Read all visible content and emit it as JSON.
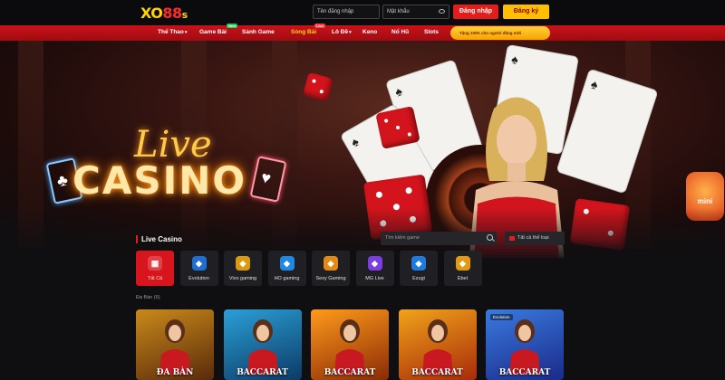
{
  "header": {
    "logo": {
      "main": "XO",
      "num": "88",
      "suffix": "s"
    },
    "username_placeholder": "Tên đăng nhập",
    "password_placeholder": "Mật khẩu",
    "login_label": "Đăng nhập",
    "register_label": "Đăng ký"
  },
  "nav": {
    "items": [
      {
        "label": "Thể Thao",
        "chevron": "▾"
      },
      {
        "label": "Game Bài",
        "badge": "New"
      },
      {
        "label": "Sảnh Game"
      },
      {
        "label": "Sòng Bài",
        "badge": "Live"
      },
      {
        "label": "Lô Đề",
        "chevron": "▾"
      },
      {
        "label": "Keno"
      },
      {
        "label": "Nổ Hũ"
      },
      {
        "label": "Slots"
      }
    ],
    "promo": "Tặng 100K cho người đăng mới"
  },
  "hero": {
    "title_script": "Live",
    "title_main": "CASINO",
    "sticker": "mini"
  },
  "live_casino": {
    "title": "Live Casino",
    "search_placeholder": "Tìm kiếm game",
    "filter_selected": "Tất cả thể loại",
    "providers": [
      {
        "label": "Tất Cả",
        "icon": "grid-icon",
        "color": "#d8141c"
      },
      {
        "label": "Evolution",
        "icon": "evolution-icon",
        "color": "#1f6fd1"
      },
      {
        "label": "Vivo gaming",
        "icon": "vivo-icon",
        "color": "#d99a10"
      },
      {
        "label": "HO gaming",
        "icon": "ho-icon",
        "color": "#1e88e5"
      },
      {
        "label": "Sexy Gaming",
        "icon": "sexy-icon",
        "color": "#e38a12"
      },
      {
        "label": "MG Live",
        "icon": "mg-icon",
        "color": "#7b3fe0"
      },
      {
        "label": "Ezugi",
        "icon": "ezugi-icon",
        "color": "#1f7ae0"
      },
      {
        "label": "Ebet",
        "icon": "ebet-icon",
        "color": "#e39a12"
      }
    ],
    "subheading": "Đa Bàn (6)",
    "games": [
      {
        "title": "ĐA BÀN",
        "tag": "",
        "color1": "#c98a1a",
        "color2": "#5a2a0a"
      },
      {
        "title": "BACCARAT",
        "tag": "",
        "color1": "#2aa0d6",
        "color2": "#0c3a66"
      },
      {
        "title": "BACCARAT",
        "tag": "",
        "color1": "#ff9a1a",
        "color2": "#8a2a06"
      },
      {
        "title": "BACCARAT",
        "tag": "",
        "color1": "#f0a31a",
        "color2": "#a82a0a"
      },
      {
        "title": "BACCARAT",
        "tag": "Evolution",
        "color1": "#3a7ae0",
        "color2": "#1a2a8a"
      }
    ]
  }
}
